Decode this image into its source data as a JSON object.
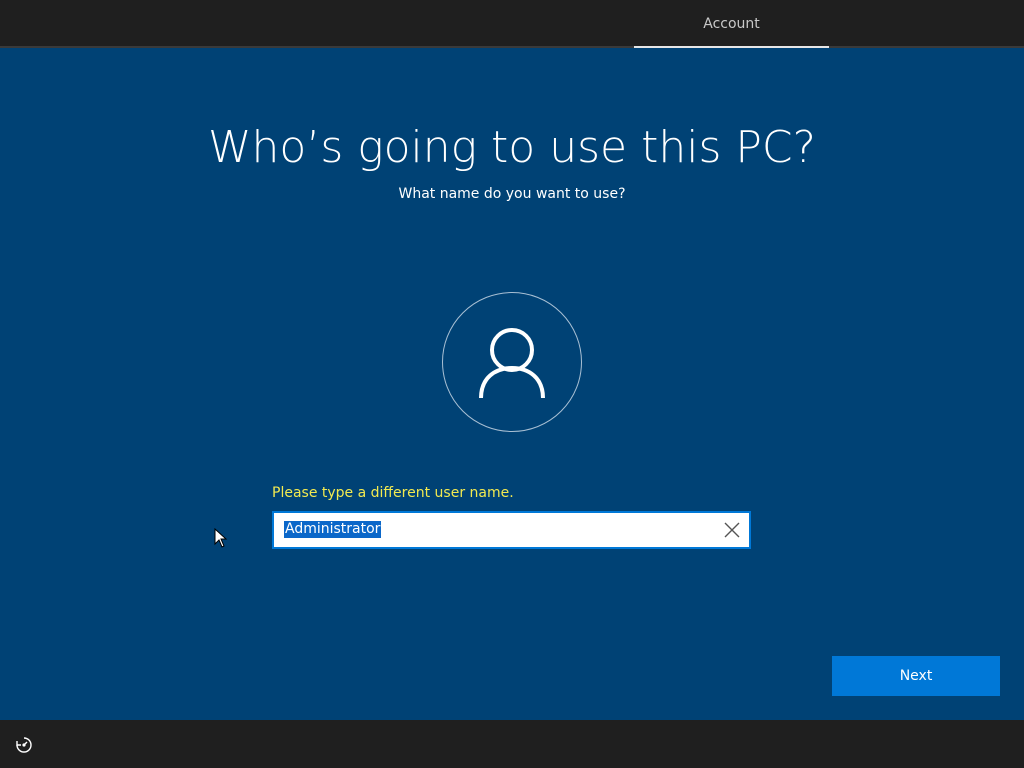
{
  "header": {
    "tabs": [
      {
        "label": "Account",
        "active": true
      }
    ]
  },
  "main": {
    "title": "Who’s going to use this PC?",
    "subtitle": "What name do you want to use?",
    "avatar_icon": "user-icon",
    "error_message": "Please type a different user name.",
    "username_field": {
      "value": "Administrator",
      "selected": true,
      "clear_icon": "close-icon"
    },
    "next_label": "Next"
  },
  "footer": {
    "accessibility_icon": "ease-of-access-icon"
  },
  "colors": {
    "background": "#004275",
    "bars": "#1f1f1f",
    "accent": "#0078d7",
    "error_text": "#f2ea50",
    "selection": "#0b67c9"
  }
}
